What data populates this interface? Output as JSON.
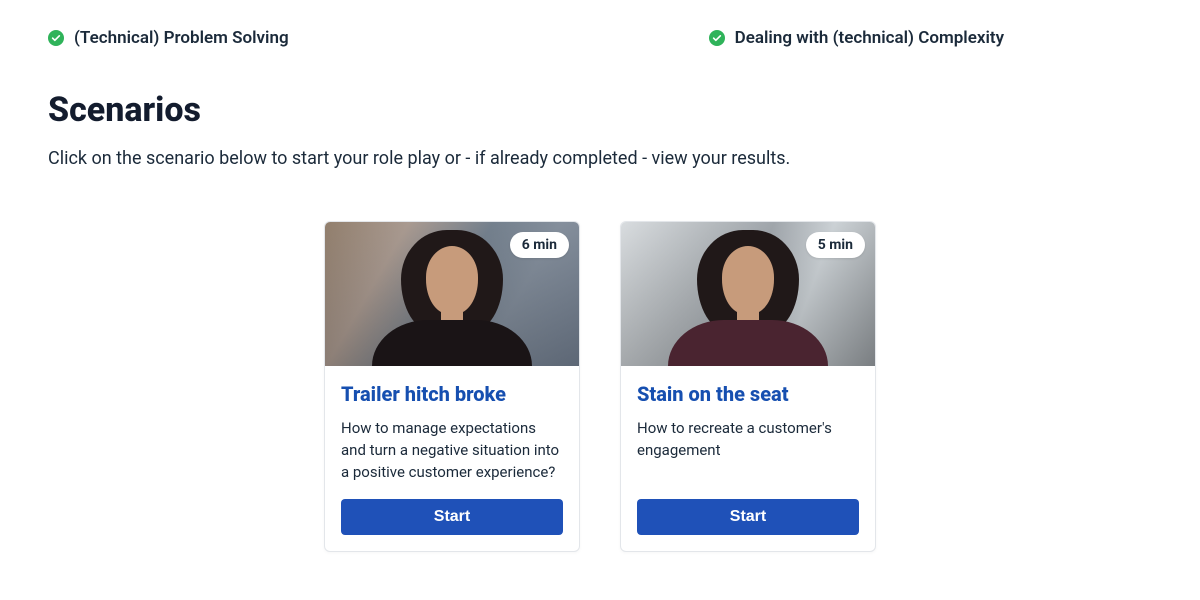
{
  "competencies": [
    {
      "label": "(Technical) Problem Solving"
    },
    {
      "label": "Dealing with (technical) Complexity"
    }
  ],
  "heading": "Scenarios",
  "subtext": "Click on the scenario below to start your role play or - if already completed - view your results.",
  "cards": [
    {
      "duration": "6 min",
      "title": "Trailer hitch broke",
      "desc": "How to manage expectations and turn a negative situation into a positive customer experience?",
      "cta": "Start"
    },
    {
      "duration": "5 min",
      "title": "Stain on the seat",
      "desc": "How to recreate a customer's engagement",
      "cta": "Start"
    }
  ],
  "colors": {
    "accent": "#1f51b8",
    "success": "#2fb35a",
    "linkTitle": "#164fb0"
  }
}
